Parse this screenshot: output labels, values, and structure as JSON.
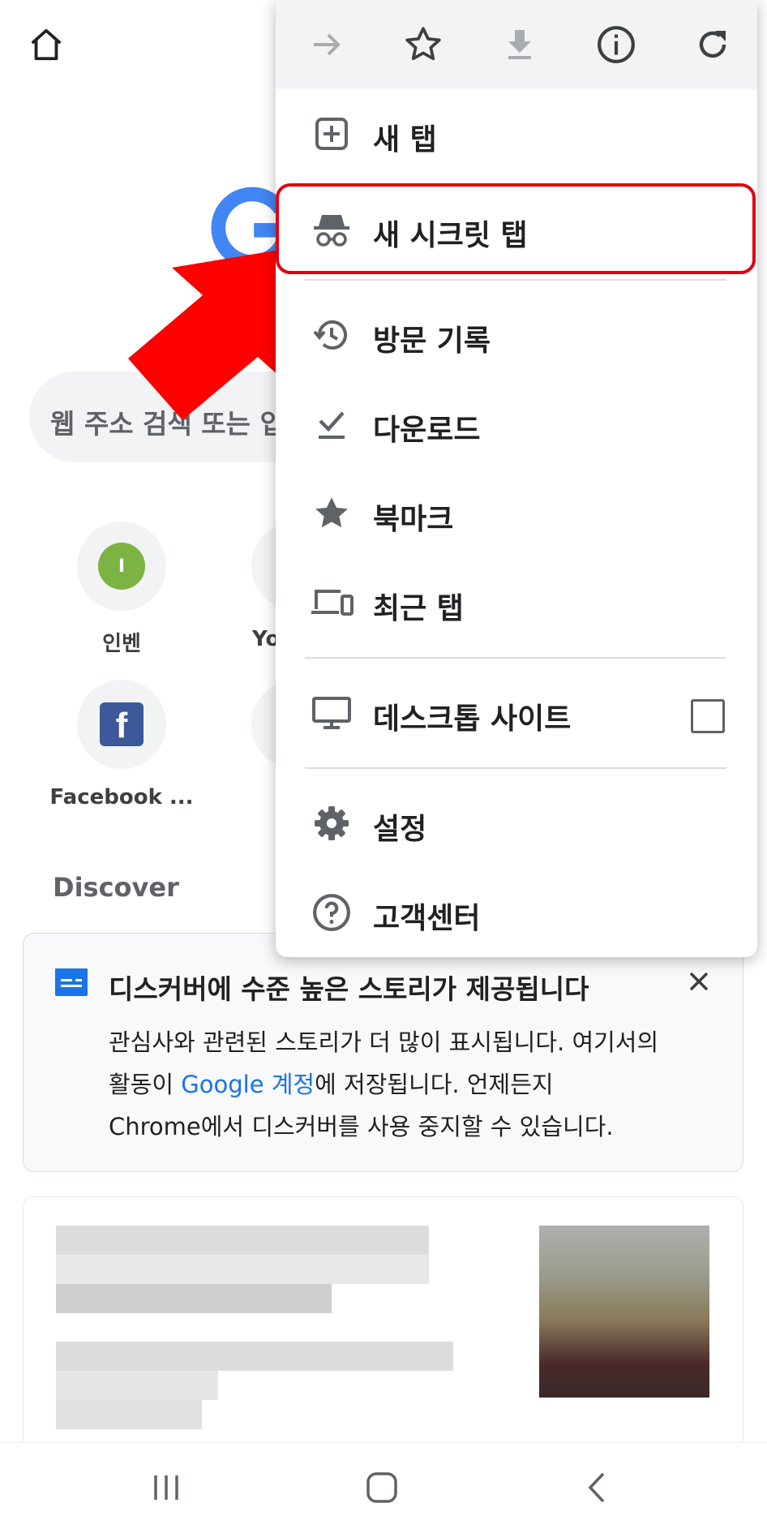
{
  "background": {
    "search_placeholder": "웹 주소 검색 또는 입력",
    "shortcuts": [
      {
        "label": "인벤",
        "initial": "I",
        "color": "#7cb342"
      },
      {
        "label": "Yo",
        "initial": "",
        "color": "#f1f3f4"
      },
      {
        "label": "Facebook ...",
        "initial": "f",
        "color": "#3b5998"
      }
    ],
    "discover": {
      "title": "Discover",
      "card_title": "디스커버에 수준 높은 스토리가 제공됩니다",
      "line1": "관심사와 관련된 스토리가 더 많이 표시됩니다. 여기서의",
      "line2_prefix": "활동이 ",
      "line2_link": "Google 계정",
      "line2_suffix": "에 저장됩니다. 언제든지",
      "line3": "Chrome에서 디스커버를 사용 중지할 수 있습니다."
    }
  },
  "menu": {
    "toolbar_icons": [
      "forward-icon",
      "bookmark-star-icon",
      "download-icon",
      "info-icon",
      "refresh-icon"
    ],
    "items": [
      {
        "label": "새 탭",
        "icon": "new-tab-icon"
      },
      {
        "label": "새 시크릿 탭",
        "icon": "incognito-icon",
        "highlighted": true
      },
      {
        "label": "방문 기록",
        "icon": "history-icon"
      },
      {
        "label": "다운로드",
        "icon": "downloads-icon"
      },
      {
        "label": "북마크",
        "icon": "bookmarks-icon"
      },
      {
        "label": "최근 탭",
        "icon": "recent-tabs-icon"
      },
      {
        "label": "데스크톱 사이트",
        "icon": "desktop-icon",
        "checked": false
      },
      {
        "label": "설정",
        "icon": "settings-icon"
      },
      {
        "label": "고객센터",
        "icon": "help-icon"
      }
    ]
  },
  "colors": {
    "highlight": "#e00010",
    "arrow": "#ff0000",
    "link": "#1a73e8"
  }
}
